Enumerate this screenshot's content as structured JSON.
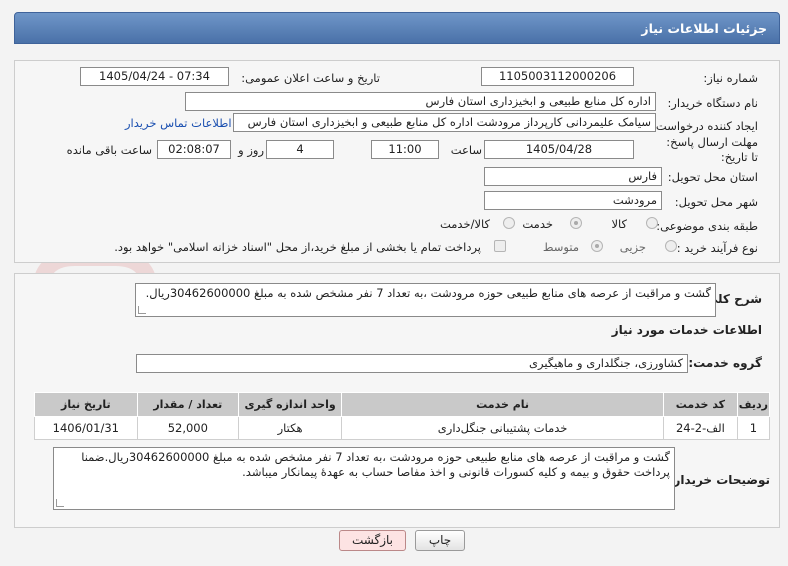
{
  "header": {
    "title": "جزئیات اطلاعات نیاز"
  },
  "form": {
    "need_number_label": "شماره نیاز:",
    "need_number": "1105003112000206",
    "announce_label": "تاریخ و ساعت اعلان عمومی:",
    "announce_value": "1405/04/24 - 07:34",
    "buyer_org_label": "نام دستگاه خریدار:",
    "buyer_org": "اداره کل منابع طبیعی و ابخیزداری استان فارس",
    "creator_label": "ایجاد کننده درخواست:",
    "creator": "سیامک علیمردانی کارپرداز مرودشت اداره کل منابع طبیعی و ابخیزداری استان فارس",
    "contact_link": "اطلاعات تماس خریدار",
    "deadline_label": "مهلت ارسال پاسخ: تا تاریخ:",
    "deadline_date": "1405/04/28",
    "time_label": "ساعت",
    "deadline_time": "11:00",
    "days_value": "4",
    "days_label": "روز و",
    "remaining_time": "02:08:07",
    "remaining_label": "ساعت باقی مانده",
    "province_label": "استان محل تحویل:",
    "province": "فارس",
    "city_label": "شهر محل تحویل:",
    "city": "مرودشت",
    "category_label": "طبقه بندی موضوعی:",
    "category_options": [
      "کالا",
      "خدمت",
      "کالا/خدمت"
    ],
    "category_selected": "خدمت",
    "process_label": "نوع فرآیند خرید :",
    "process_options": [
      "جزیی",
      "متوسط"
    ],
    "process_selected": "متوسط",
    "payment_note": "پرداخت تمام یا بخشی از مبلغ خرید،از محل \"اسناد خزانه اسلامی\" خواهد بود."
  },
  "description": {
    "label": "شرح کلی نیاز:",
    "text": "گشت و مراقبت از عرصه های منابع طبیعی حوزه مرودشت ،به تعداد 7 نفر مشخص شده به مبلغ 30462600000ریال."
  },
  "services": {
    "section_title": "اطلاعات خدمات مورد نیاز",
    "group_label": "گروه خدمت:",
    "group_value": "کشاورزی، جنگلداری و ماهیگیری",
    "columns": [
      "ردیف",
      "کد خدمت",
      "نام خدمت",
      "واحد اندازه گیری",
      "تعداد / مقدار",
      "تاریخ نیاز"
    ],
    "rows": [
      [
        "1",
        "الف-2-24",
        "خدمات پشتیبانی جنگل‌داری",
        "هکتار",
        "52,000",
        "1406/01/31"
      ]
    ]
  },
  "buyer_notes": {
    "label": "توضیحات خریدار:",
    "text": "گشت و مراقبت از عرصه های منابع طبیعی حوزه مرودشت ،به تعداد 7 نفر مشخص شده به مبلغ 30462600000ریال.ضمنا پرداخت حقوق و بیمه و کلیه کسورات قانونی و اخذ مفاصا حساب به عهدهٔ پیمانکار میباشد."
  },
  "buttons": {
    "print": "چاپ",
    "back": "بازگشت"
  },
  "watermark": "AriaTender.net",
  "colors": {
    "header": "#5a80b8",
    "back_button": "#fde3e3"
  }
}
